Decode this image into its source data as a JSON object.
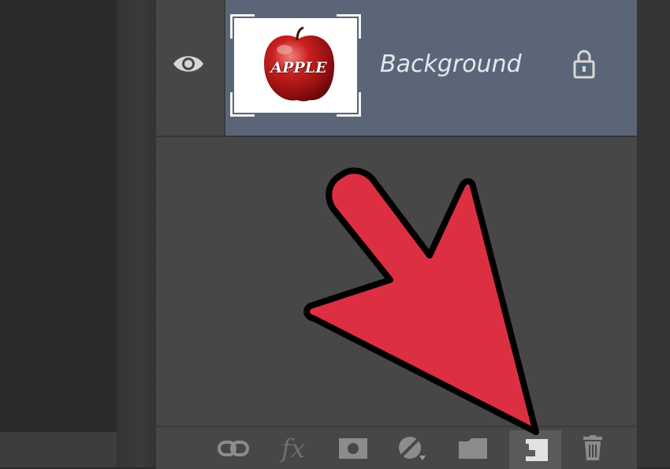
{
  "layers_panel": {
    "layers": [
      {
        "name": "Background",
        "visible": true,
        "locked": true,
        "selected": true,
        "thumbnail_text": "APPLE"
      }
    ]
  },
  "toolbar": {
    "buttons": [
      {
        "icon": "link-icon"
      },
      {
        "icon": "fx-icon",
        "label": "fx"
      },
      {
        "icon": "mask-icon"
      },
      {
        "icon": "adjustment-icon"
      },
      {
        "icon": "folder-icon"
      },
      {
        "icon": "new-layer-icon",
        "active": true
      },
      {
        "icon": "trash-icon"
      }
    ]
  },
  "colors": {
    "panel_bg": "#474747",
    "selected_layer": "#5a6678",
    "arrow_fill": "#dc2f42",
    "arrow_stroke": "#000000",
    "icon": "#8c8c8c"
  }
}
